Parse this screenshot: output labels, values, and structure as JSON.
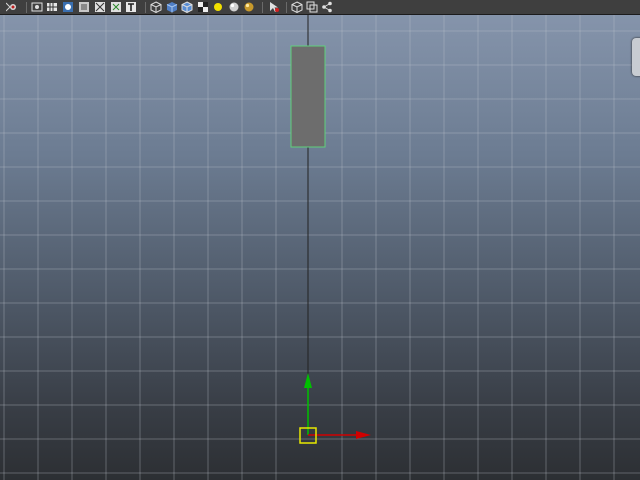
{
  "toolbar": {
    "icons": [
      "select-camera-icon",
      "camera-attributes-icon",
      "grid-toggle-icon",
      "film-gate-icon",
      "resolution-gate-icon",
      "safe-title-icon",
      "wireframe-icon",
      "smooth-shade-icon",
      "shaded-wireframe-icon",
      "default-material-icon",
      "textured-icon",
      "use-all-lights-icon",
      "shadows-icon",
      "screen-space-ao-icon",
      "motion-blur-icon",
      "isolate-select-icon",
      "xray-icon",
      "xray-active-components-icon",
      "xray-joints-icon"
    ]
  },
  "viewport": {
    "view_cube_tab_icon": "view-cube-icon",
    "selected_object_icon": "selected-mesh-icon",
    "manipulator_icon": "move-manipulator-icon"
  },
  "colors": {
    "toolbar_bg": "#3f3f3f",
    "viewport_top": "#8594ab",
    "viewport_bottom": "#2c2f33",
    "grid": "#bfc6cf",
    "selection": "#5ed17a",
    "axis_y": "#00c000",
    "axis_x": "#d00000",
    "pivot": "#e8e800"
  }
}
